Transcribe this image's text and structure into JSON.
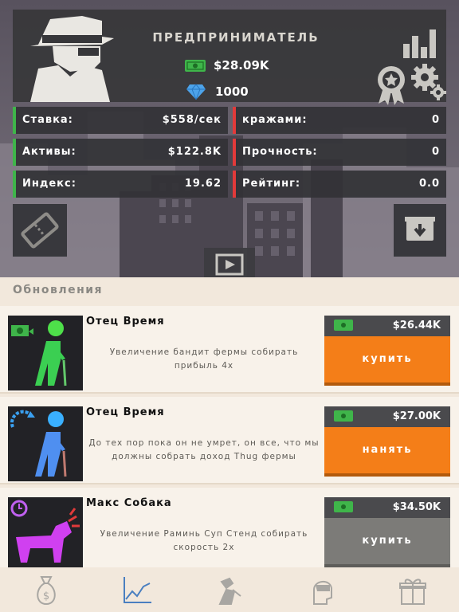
{
  "header": {
    "title": "ПРЕДПРИНИМАТЕЛЬ",
    "money": "$28.09K",
    "gems": "1000"
  },
  "stats": {
    "rate_label": "Ставка:",
    "rate_value": "$558/сек",
    "assets_label": "Активы:",
    "assets_value": "$122.8K",
    "index_label": "Индекс:",
    "index_value": "19.62",
    "thefts_label": "кражами:",
    "thefts_value": "0",
    "durability_label": "Прочность:",
    "durability_value": "0",
    "rating_label": "Рейтинг:",
    "rating_value": "0.0"
  },
  "upgrades": {
    "section_title": "Обновления",
    "items": [
      {
        "name": "Отец Время",
        "description": "Увеличение бандит фермы собирать прибыль 4x",
        "price": "$26.44K",
        "action": "купить"
      },
      {
        "name": "Отец Время",
        "description": "До тех пор пока он не умрет, он все, что мы должны собрать доход Thug фермы",
        "price": "$27.00K",
        "action": "нанять"
      },
      {
        "name": "Макс Собака",
        "description": "Увеличение Раминь Суп Стенд собирать скорость 2x",
        "price": "$34.50K",
        "action": "купить"
      }
    ]
  },
  "colors": {
    "accent_orange": "#f47e18",
    "stat_green": "#3fb54a",
    "stat_red": "#e23a3a",
    "disabled_gray": "#7c7b78"
  },
  "icons": {
    "nav": [
      "money-bag-icon",
      "chart-line-icon",
      "thief-icon",
      "advisor-icon",
      "gift-icon"
    ]
  }
}
